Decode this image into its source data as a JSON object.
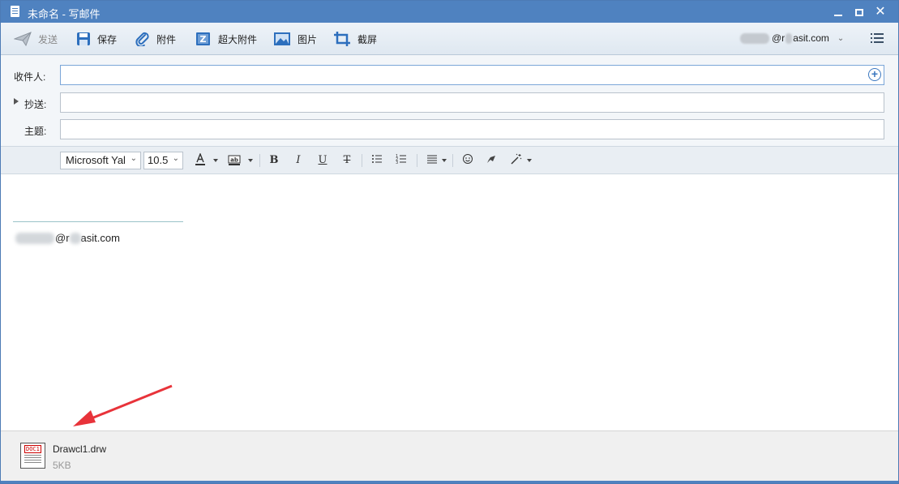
{
  "window": {
    "title": "未命名 - 写邮件"
  },
  "toolbar": {
    "send_label": "发送",
    "save_label": "保存",
    "attach_label": "附件",
    "big_attach_label": "超大附件",
    "image_label": "图片",
    "screenshot_label": "截屏",
    "account_visible": "@r",
    "account_domain": "asit.com"
  },
  "fields": {
    "to_label": "收件人:",
    "cc_label": "抄送:",
    "subject_label": "主题:",
    "to_value": "",
    "cc_value": "",
    "subject_value": ""
  },
  "format": {
    "font_family": "Microsoft Yal",
    "font_size": "10.5"
  },
  "editor": {
    "signature_at": "@r",
    "signature_domain": "asit.com"
  },
  "attachment": {
    "file_name": "Drawcl1.drw",
    "file_size": "5KB",
    "icon_tag": "DOC1"
  },
  "colors": {
    "titlebar": "#4f82c0",
    "accent": "#3c78c0",
    "annotation_arrow": "#e8333a"
  }
}
